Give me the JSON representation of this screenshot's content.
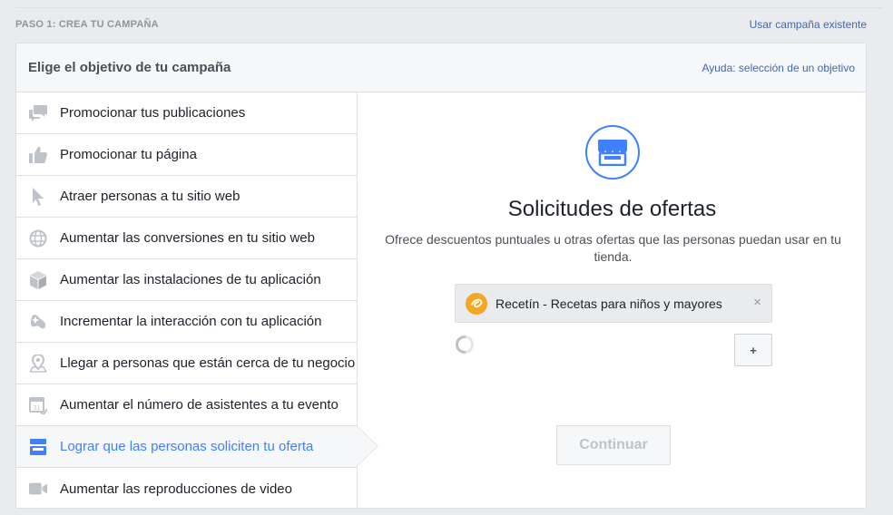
{
  "step": {
    "label": "PASO 1: CREA TU CAMPAÑA",
    "use_existing_link": "Usar campaña existente"
  },
  "card": {
    "title": "Elige el objetivo de tu campaña",
    "help_link": "Ayuda: selección de un objetivo"
  },
  "objectives": [
    {
      "label": "Promocionar tus publicaciones",
      "icon": "speech-bubbles-icon",
      "selected": false
    },
    {
      "label": "Promocionar tu página",
      "icon": "thumbs-up-icon",
      "selected": false
    },
    {
      "label": "Atraer personas a tu sitio web",
      "icon": "cursor-icon",
      "selected": false
    },
    {
      "label": "Aumentar las conversiones en tu sitio web",
      "icon": "globe-icon",
      "selected": false
    },
    {
      "label": "Aumentar las instalaciones de tu aplicación",
      "icon": "box-icon",
      "selected": false
    },
    {
      "label": "Incrementar la interacción con tu aplicación",
      "icon": "gamepad-icon",
      "selected": false
    },
    {
      "label": "Llegar a personas que están cerca de tu negocio",
      "icon": "location-pin-icon",
      "selected": false
    },
    {
      "label": "Aumentar el número de asistentes a tu evento",
      "icon": "calendar-icon",
      "selected": false
    },
    {
      "label": "Lograr que las personas soliciten tu oferta",
      "icon": "storefront-icon",
      "selected": true
    },
    {
      "label": "Aumentar las reproducciones de video",
      "icon": "video-camera-icon",
      "selected": false
    }
  ],
  "detail": {
    "icon": "storefront-icon",
    "title": "Solicitudes de ofertas",
    "description": "Ofrece descuentos puntuales u otras ofertas que las personas puedan usar en tu tienda.",
    "page": {
      "name": "Recetín - Recetas para niños y mayores",
      "remove_symbol": "×"
    },
    "add_button": "+",
    "continue_button": "Continuar"
  },
  "colors": {
    "accent": "#4080ff",
    "link": "#4267b2",
    "icon_gray": "#bec3c9",
    "selected_bg": "#f6f7f9",
    "avatar": "#f5a623"
  }
}
